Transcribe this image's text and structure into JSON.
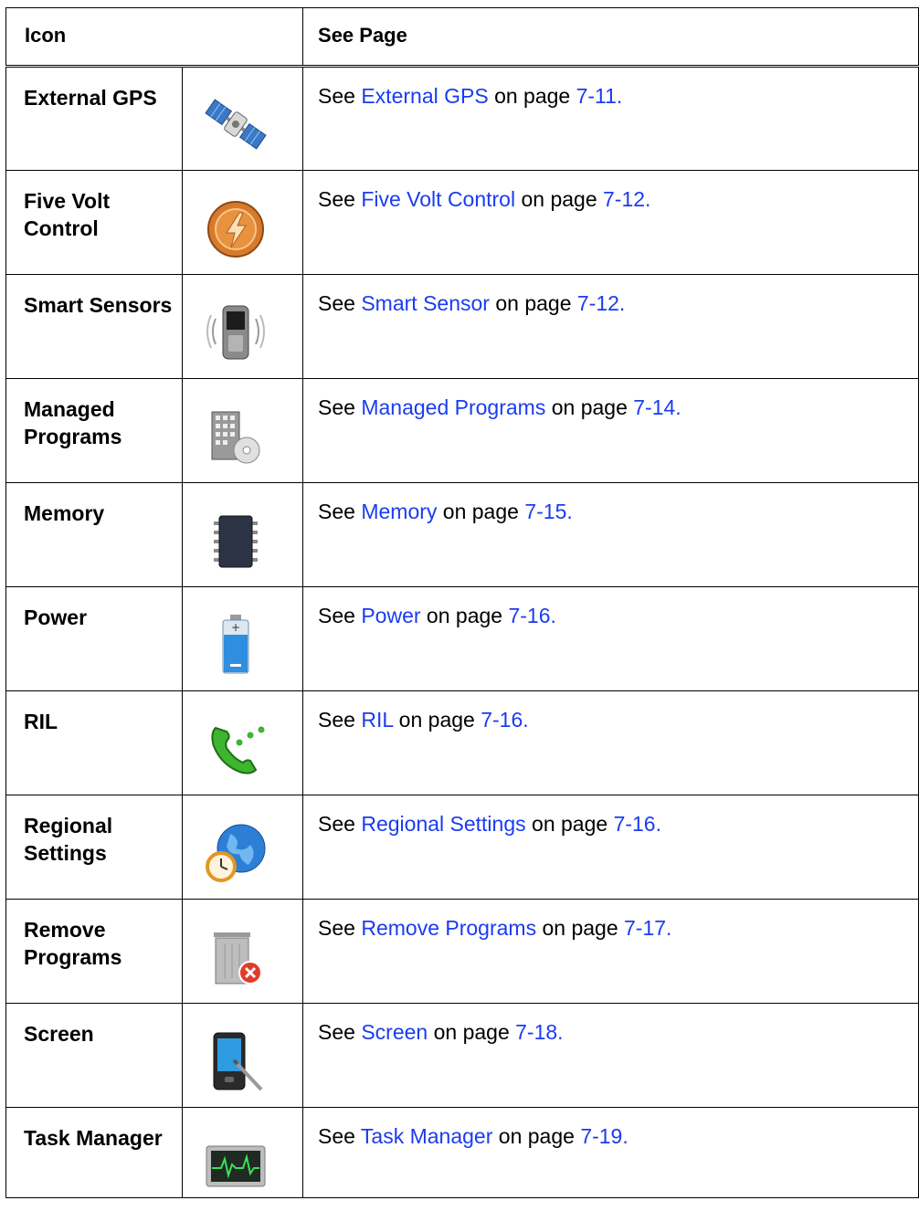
{
  "table": {
    "headers": {
      "icon": "Icon",
      "see_page": "See Page"
    },
    "rows": [
      {
        "name": "External GPS",
        "icon": "satellite-icon",
        "see": "See ",
        "link": "External GPS",
        "on_page": " on page ",
        "page": "7-11."
      },
      {
        "name": "Five Volt Control",
        "icon": "lightning-bolt-icon",
        "see": "See ",
        "link": "Five Volt Control",
        "on_page": " on page ",
        "page": "7-12."
      },
      {
        "name": "Smart Sensors",
        "icon": "vibrating-phone-icon",
        "see": "See ",
        "link": "Smart Sensor",
        "on_page": " on page ",
        "page": "7-12."
      },
      {
        "name": "Managed Programs",
        "icon": "building-disc-icon",
        "see": "See ",
        "link": "Managed Programs",
        "on_page": " on page ",
        "page": "7-14."
      },
      {
        "name": "Memory",
        "icon": "memory-chip-icon",
        "see": "See ",
        "link": "Memory",
        "on_page": " on page ",
        "page": "7-15."
      },
      {
        "name": "Power",
        "icon": "battery-icon",
        "see": "See ",
        "link": "Power",
        "on_page": " on page ",
        "page": "7-16."
      },
      {
        "name": "RIL",
        "icon": "phone-handset-icon",
        "see": "See ",
        "link": "RIL",
        "on_page": " on page ",
        "page": "7-16."
      },
      {
        "name": "Regional Settings",
        "icon": "globe-clock-icon",
        "see": "See ",
        "link": "Regional Settings",
        "on_page": " on page ",
        "page": "7-16."
      },
      {
        "name": "Remove Programs",
        "icon": "trash-remove-icon",
        "see": "See ",
        "link": "Remove Programs",
        "on_page": " on page ",
        "page": "7-17."
      },
      {
        "name": "Screen",
        "icon": "pda-stylus-icon",
        "see": "See ",
        "link": "Screen",
        "on_page": " on page ",
        "page": "7-18."
      },
      {
        "name": "Task Manager",
        "icon": "activity-monitor-icon",
        "see": "See ",
        "link": "Task Manager",
        "on_page": " on page ",
        "page": "7-19."
      }
    ]
  },
  "colors": {
    "link": "#1a3cf0",
    "text": "#000000",
    "border": "#000000"
  }
}
